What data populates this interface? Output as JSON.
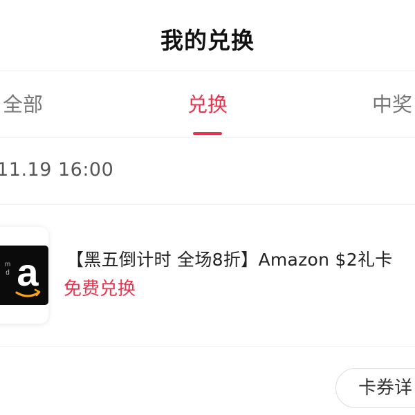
{
  "header": {
    "title": "我的兑换"
  },
  "tabs": [
    {
      "label": "全部",
      "active": false
    },
    {
      "label": "兑换",
      "active": true
    },
    {
      "label": "中奖",
      "active": false
    }
  ],
  "colors": {
    "accent": "#e8344e",
    "divider": "#eeeeee"
  },
  "order": {
    "time": ".11.19 16:00",
    "product": {
      "thumb_icon": "amazon-logo-icon",
      "thumb_text": "m d",
      "title": "【黑五倒计时 全场8折】Amazon $2礼卡",
      "status": "免费兑换"
    },
    "detail_button": "卡券详"
  }
}
